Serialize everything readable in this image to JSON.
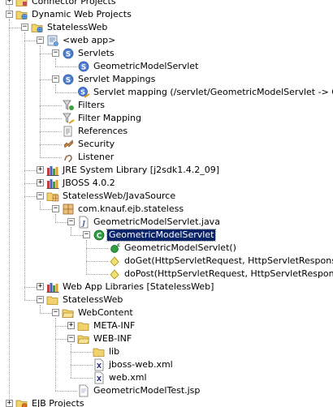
{
  "tree": [
    {
      "label": "Connector Projects",
      "depth": 0,
      "icon": "connector-project-icon",
      "toggle": "plus",
      "cut": true
    },
    {
      "label": "Dynamic Web Projects",
      "depth": 0,
      "icon": "folder-web-icon",
      "toggle": "minus"
    },
    {
      "label": "StatelessWeb",
      "depth": 1,
      "icon": "web-project-icon",
      "toggle": "minus"
    },
    {
      "label": "<web app>",
      "depth": 2,
      "icon": "web-app-icon",
      "toggle": "minus"
    },
    {
      "label": "Servlets",
      "depth": 3,
      "icon": "servlet-s-icon",
      "toggle": "minus"
    },
    {
      "label": "GeometricModelServlet",
      "depth": 4,
      "icon": "servlet-s-icon"
    },
    {
      "label": "Servlet Mappings",
      "depth": 3,
      "icon": "servlet-s-icon",
      "toggle": "minus"
    },
    {
      "label": "Servlet mapping (/servlet/GeometricModelServlet -> Geomet",
      "depth": 4,
      "icon": "servlet-mapping-icon"
    },
    {
      "label": "Filters",
      "depth": 3,
      "icon": "filter-icon"
    },
    {
      "label": "Filter Mapping",
      "depth": 3,
      "icon": "filter-mapping-icon"
    },
    {
      "label": "References",
      "depth": 3,
      "icon": "references-icon"
    },
    {
      "label": "Security",
      "depth": 3,
      "icon": "security-icon"
    },
    {
      "label": "Listener",
      "depth": 3,
      "icon": "listener-icon"
    },
    {
      "label": "JRE System Library [j2sdk1.4.2_09]",
      "depth": 2,
      "icon": "library-icon",
      "toggle": "plus"
    },
    {
      "label": "JBOSS 4.0.2",
      "depth": 2,
      "icon": "library-icon",
      "toggle": "plus"
    },
    {
      "label": "StatelessWeb/JavaSource",
      "depth": 2,
      "icon": "source-folder-icon",
      "toggle": "minus"
    },
    {
      "label": "com.knauf.ejb.stateless",
      "depth": 3,
      "icon": "package-icon",
      "toggle": "minus"
    },
    {
      "label": "GeometricModelServlet.java",
      "depth": 4,
      "icon": "java-file-icon",
      "toggle": "minus"
    },
    {
      "label": "GeometricModelServlet",
      "depth": 5,
      "icon": "class-icon",
      "toggle": "minus",
      "selected": true
    },
    {
      "label": "GeometricModelServlet()",
      "depth": 6,
      "icon": "constructor-icon"
    },
    {
      "label": "doGet(HttpServletRequest, HttpServletResponse)",
      "depth": 6,
      "icon": "protected-method-icon"
    },
    {
      "label": "doPost(HttpServletRequest, HttpServletResponse)",
      "depth": 6,
      "icon": "protected-method-icon"
    },
    {
      "label": "Web App Libraries [StatelessWeb]",
      "depth": 2,
      "icon": "library-icon",
      "toggle": "plus"
    },
    {
      "label": "StatelessWeb",
      "depth": 2,
      "icon": "folder-icon",
      "toggle": "minus"
    },
    {
      "label": "WebContent",
      "depth": 3,
      "icon": "folder-open-icon",
      "toggle": "minus"
    },
    {
      "label": "META-INF",
      "depth": 4,
      "icon": "folder-icon",
      "toggle": "plus"
    },
    {
      "label": "WEB-INF",
      "depth": 4,
      "icon": "folder-open-icon",
      "toggle": "minus"
    },
    {
      "label": "lib",
      "depth": 5,
      "icon": "folder-icon"
    },
    {
      "label": "jboss-web.xml",
      "depth": 5,
      "icon": "xml-file-icon"
    },
    {
      "label": "web.xml",
      "depth": 5,
      "icon": "xml-file-icon"
    },
    {
      "label": "GeometricModelTest.jsp",
      "depth": 4,
      "icon": "jsp-file-icon"
    },
    {
      "label": "EJB Projects",
      "depth": 0,
      "icon": "ejb-project-icon",
      "toggle": "plus"
    }
  ],
  "colors": {
    "selection": "#0a246a",
    "selection_text": "#ffffff",
    "tree_lines": "#a0a0a0"
  }
}
